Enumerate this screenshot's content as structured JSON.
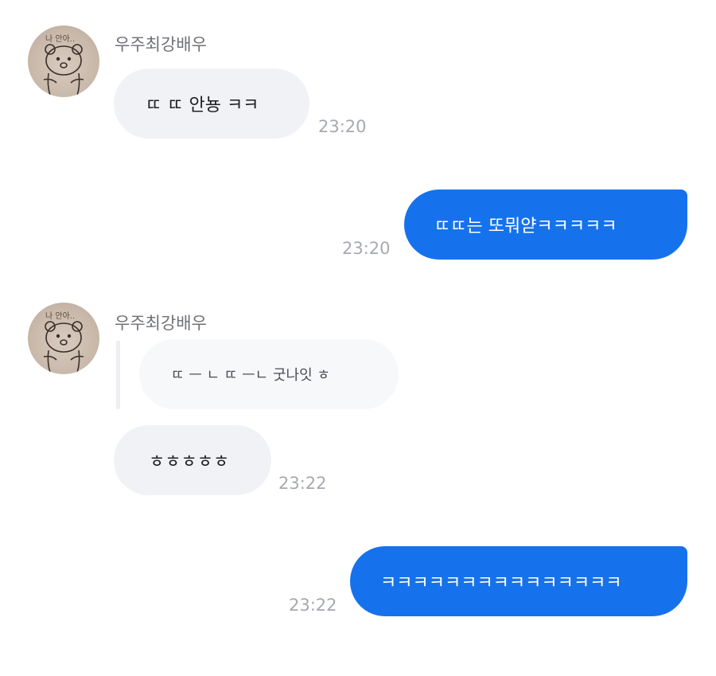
{
  "sender_name": "우주최강배우",
  "messages": [
    {
      "text": "ㄸ ㄸ 안뇽 ㅋㅋ",
      "time": "23:20"
    },
    {
      "text": "ㄸㄸ는 또뭐얃ㅋㅋㅋㅋㅋ",
      "time": "23:20"
    },
    {
      "quoted_text": "ㄸ ㅡ ㄴ ㄸ ㅡㄴ 굿나잇 ㅎ",
      "text": "ㅎㅎㅎㅎㅎ",
      "time": "23:22"
    },
    {
      "text": "ㅋㅋㅋㅋㅋㅋㅋㅋㅋㅋㅋㅋㅋㅋㅋ",
      "time": "23:22"
    }
  ],
  "avatar_caption": "나 안아.."
}
